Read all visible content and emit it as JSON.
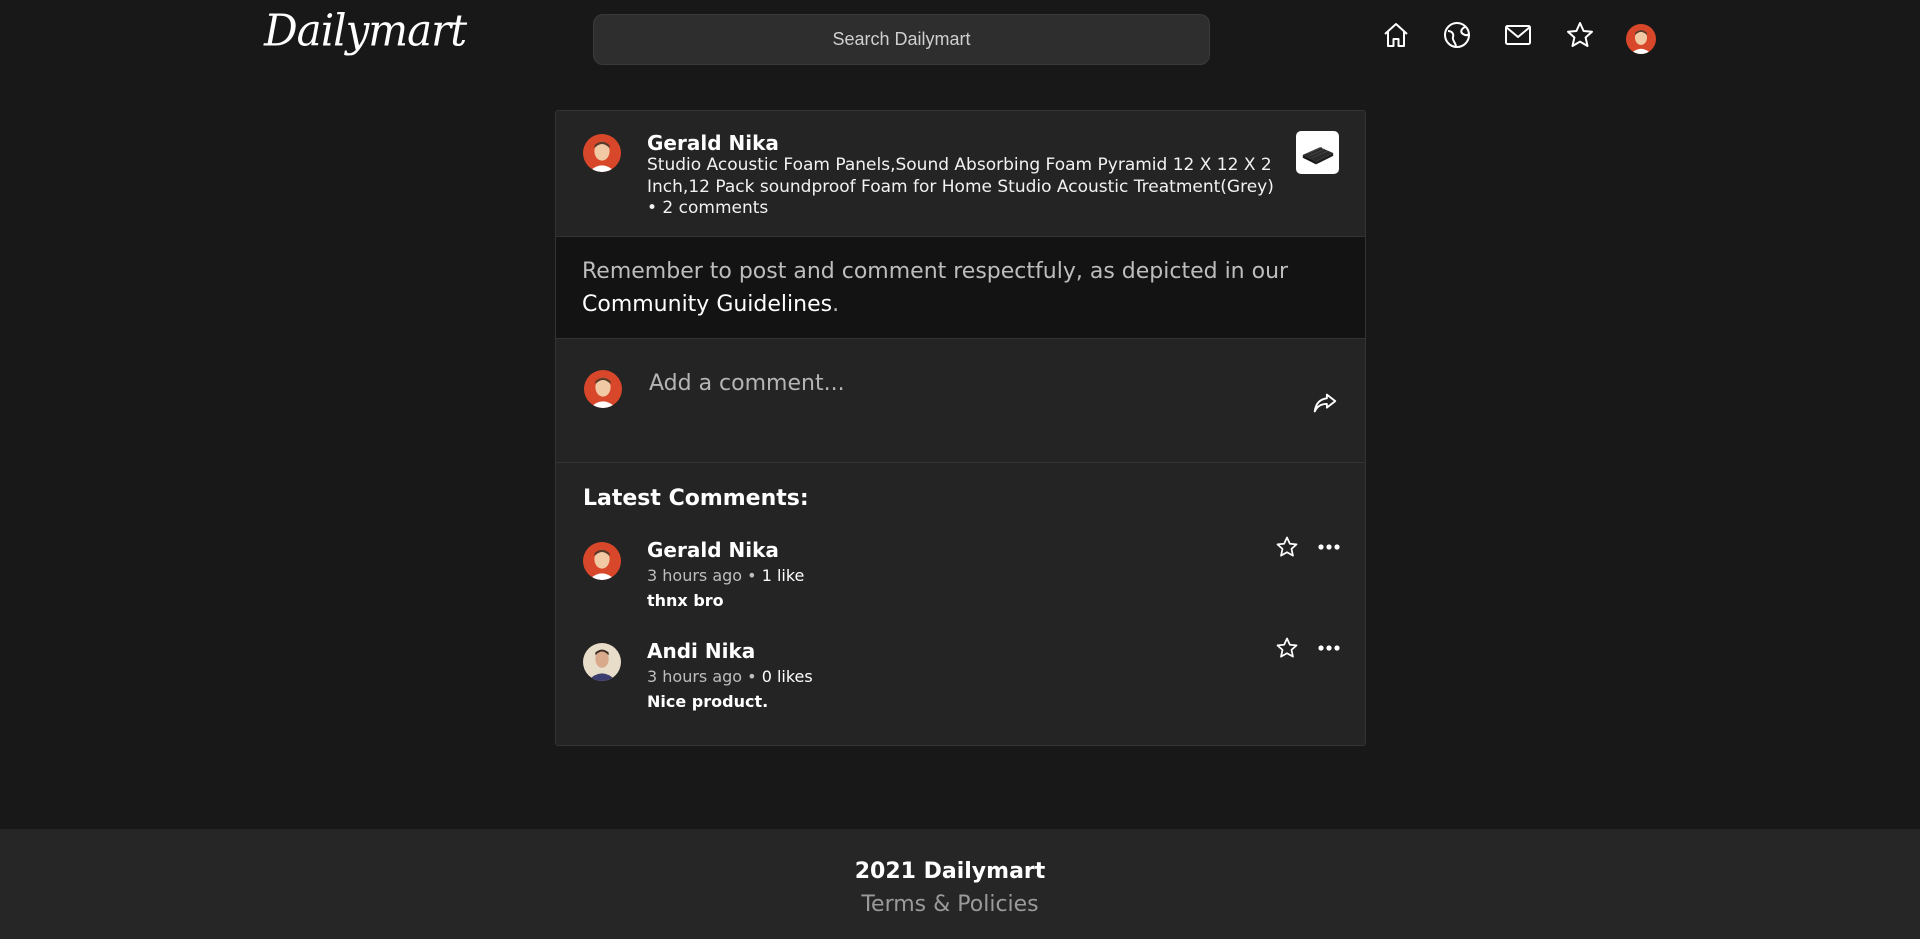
{
  "header": {
    "logo": "Dailymart",
    "search_placeholder": "Search Dailymart",
    "nav_icons": [
      "home-icon",
      "explore-icon",
      "mail-icon",
      "star-icon",
      "user-avatar"
    ]
  },
  "post": {
    "author": "Gerald Nika",
    "title": "Studio Acoustic Foam Panels,Sound Absorbing Foam Pyramid 12 X 12 X 2 Inch,12 Pack soundproof Foam for Home Studio Acoustic Treatment(Grey)",
    "comment_count": "• 2 comments"
  },
  "notice": {
    "text": "Remember to post and comment respectfuly, as depicted in our",
    "link": "Community Guidelines",
    "end": "."
  },
  "compose": {
    "placeholder": "Add a comment..."
  },
  "comments": {
    "title": "Latest Comments:",
    "items": [
      {
        "author": "Gerald Nika",
        "time": "3 hours ago •",
        "likes": "1 like",
        "text": "thnx bro"
      },
      {
        "author": "Andi Nika",
        "time": "3 hours ago •",
        "likes": "0 likes",
        "text": "Nice product."
      }
    ]
  },
  "footer": {
    "copyright": "2021 Dailymart",
    "link": "Terms & Policies"
  },
  "colors": {
    "background": "#181818",
    "card": "#242424",
    "notice_bg": "#131313",
    "footer_bg": "#262626",
    "avatar_red": "#d9472b"
  }
}
